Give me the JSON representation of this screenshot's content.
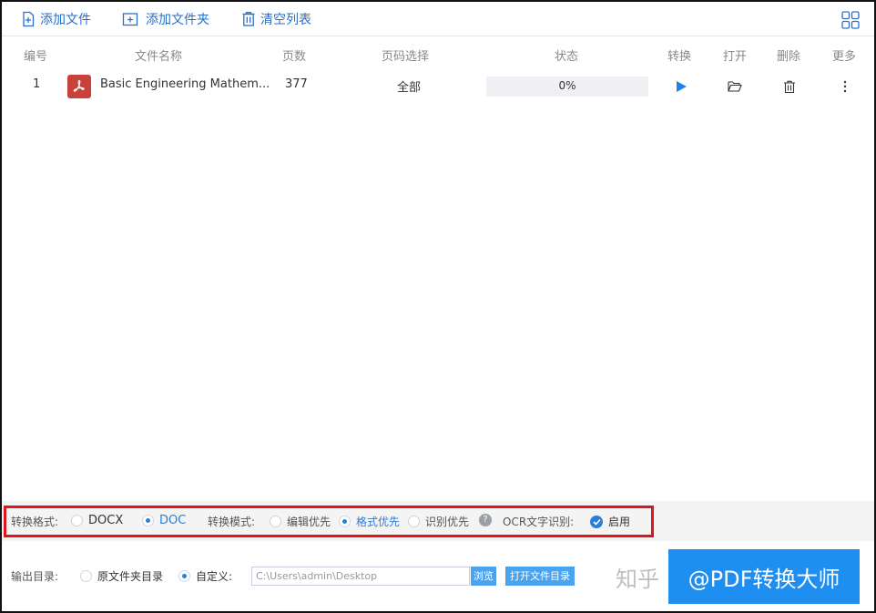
{
  "toolbar": {
    "add_file": "添加文件",
    "add_folder": "添加文件夹",
    "clear_list": "清空列表",
    "icons": [
      "add-file-icon",
      "add-folder-icon",
      "trash-icon",
      "grid-view-icon"
    ]
  },
  "table": {
    "columns": [
      "编号",
      "文件名称",
      "页数",
      "页码选择",
      "状态",
      "转换",
      "打开",
      "删除",
      "更多"
    ],
    "rows": [
      {
        "index": "1",
        "file_name": "Basic Engineering Mathem...",
        "pages": "377",
        "page_selection": "全部",
        "progress": 0,
        "status_text": "0%"
      }
    ]
  },
  "options": {
    "format_label": "转换格式:",
    "format_options": [
      "DOCX",
      "DOC"
    ],
    "format_selected": "DOC",
    "mode_label": "转换模式:",
    "mode_options": [
      "编辑优先",
      "格式优先",
      "识别优先"
    ],
    "mode_selected": "格式优先",
    "help_icon": "?",
    "ocr_label": "OCR文字识别:",
    "ocr_value": "启用",
    "ocr_enabled": true
  },
  "output": {
    "label": "输出目录:",
    "original_folder": "原文件夹目录",
    "custom": "自定义:",
    "selected": "自定义:",
    "path": "C:\\Users\\admin\\Desktop",
    "browse": "浏览",
    "open_dir": "打开文件目录"
  },
  "watermark": {
    "zh": "知乎",
    "convert_button": "@PDF转换大师"
  },
  "colors": {
    "accent": "#2a7ed8",
    "highlight_border": "#e0141b",
    "pdf_badge": "#c8413a",
    "convert_button": "#1e8ef0"
  }
}
